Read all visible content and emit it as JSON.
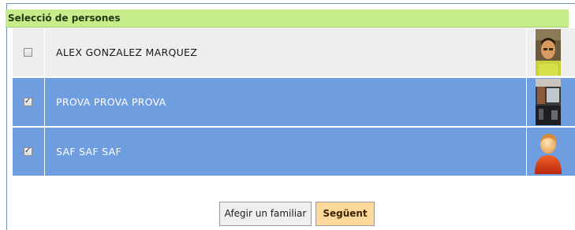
{
  "panel": {
    "title": "Selecció de persones"
  },
  "people": [
    {
      "name": "ALEX GONZALEZ MARQUEZ",
      "checked": false,
      "photo_icon": "person-photo"
    },
    {
      "name": "PROVA PROVA PROVA",
      "checked": true,
      "photo_icon": "room-photo"
    },
    {
      "name": "SAF SAF SAF",
      "checked": true,
      "photo_icon": "default-avatar-icon"
    }
  ],
  "buttons": {
    "add_label": "Afegir un familiar",
    "next_label": "Següent"
  },
  "colors": {
    "header_bg": "#c6ec8b",
    "row_unselected": "#eeeeee",
    "row_selected": "#6f9ee0",
    "next_button_bg": "#ffd99b"
  }
}
